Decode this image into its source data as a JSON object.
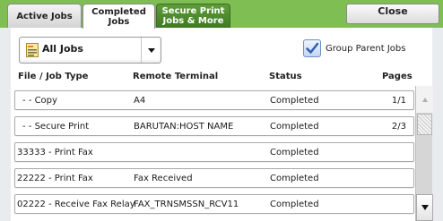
{
  "tabs": [
    {
      "label_line1": "Active Jobs",
      "label_line2": ""
    },
    {
      "label_line1": "Completed",
      "label_line2": "Jobs"
    },
    {
      "label_line1": "Secure Print",
      "label_line2": "Jobs & More"
    }
  ],
  "close_label": "Close",
  "filter": {
    "selected": "All Jobs"
  },
  "group_parent": {
    "label": "Group Parent Jobs",
    "checked": true
  },
  "columns": {
    "type": "File / Job Type",
    "terminal": "Remote Terminal",
    "status": "Status",
    "pages": "Pages"
  },
  "rows": [
    {
      "type": "-   - Copy",
      "terminal": "A4",
      "status": "Completed",
      "pages": "1/1"
    },
    {
      "type": "-   - Secure Print",
      "terminal": "BARUTAN:HOST NAME",
      "status": "Completed",
      "pages": "2/3"
    },
    {
      "type": "33333 - Print Fax",
      "terminal": "",
      "status": "Completed",
      "pages": ""
    },
    {
      "type": "22222 - Print Fax",
      "terminal": "Fax Received",
      "status": "Completed",
      "pages": ""
    },
    {
      "type": "02222 - Receive Fax Relay",
      "terminal": "FAX_TRNSMSSN_RCV11",
      "status": "Completed",
      "pages": ""
    }
  ],
  "colors": {
    "tab_bar": "#7fbe52",
    "secure_tab": "#4f8b2e",
    "panel": "#ffffff",
    "checkbox": "#4a78c8"
  }
}
